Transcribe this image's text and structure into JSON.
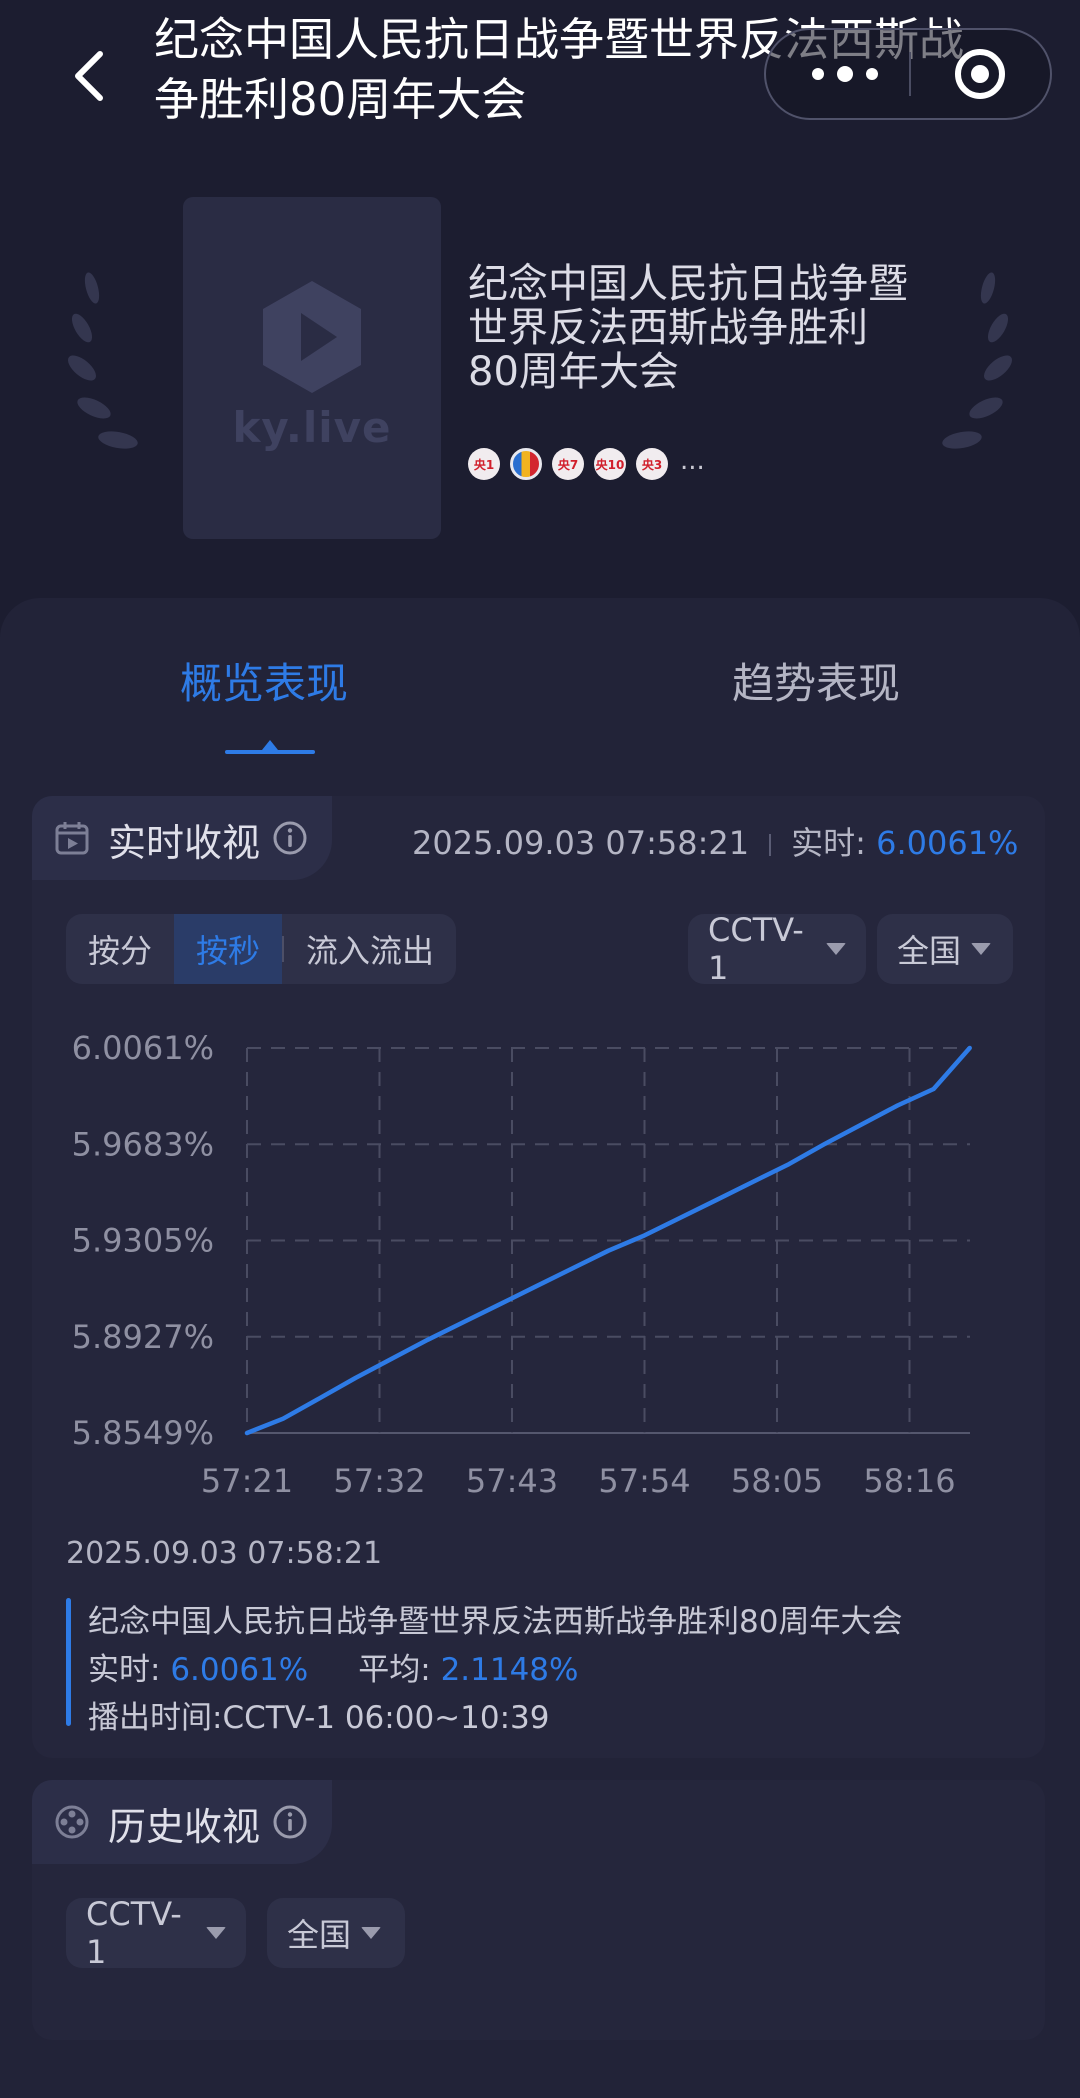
{
  "header": {
    "title": "纪念中国人民抗日战争暨世界反法西斯战争胜利80周年大会"
  },
  "hero": {
    "poster_logo_text": "ky.live",
    "show_name": "纪念中国人民抗日战争暨世界反法西斯战争胜利80周年大会",
    "channels": [
      "央1",
      "",
      "央7",
      "央10",
      "央3"
    ],
    "more": "..."
  },
  "tabs": {
    "overview": "概览表现",
    "trend": "趋势表现"
  },
  "realtime": {
    "title": "实时收视",
    "timestamp": "2025.09.03 07:58:21",
    "live_label": "实时:",
    "live_value": "6.0061%",
    "segments": [
      "按分",
      "按秒",
      "流入流出"
    ],
    "channel_select": "CCTV-1",
    "region_select": "全国"
  },
  "chart_data": {
    "type": "line",
    "y_ticks": [
      "6.0061%",
      "5.9683%",
      "5.9305%",
      "5.8927%",
      "5.8549%"
    ],
    "x_ticks": [
      "57:21",
      "57:32",
      "57:43",
      "57:54",
      "58:05",
      "58:16"
    ],
    "ylim": [
      5.8549,
      6.0061
    ],
    "grid": true,
    "series": [
      {
        "color": "#2e7be6",
        "x": [
          "57:21",
          "57:24",
          "57:27",
          "57:30",
          "57:33",
          "57:36",
          "57:39",
          "57:42",
          "57:45",
          "57:48",
          "57:51",
          "57:54",
          "57:57",
          "58:00",
          "58:03",
          "58:06",
          "58:09",
          "58:12",
          "58:15",
          "58:18",
          "58:21"
        ],
        "values": [
          5.8549,
          5.8605,
          5.8685,
          5.8765,
          5.884,
          5.8915,
          5.8985,
          5.9055,
          5.9125,
          5.9195,
          5.9265,
          5.9325,
          5.9395,
          5.9465,
          5.9535,
          5.9605,
          5.9685,
          5.976,
          5.9835,
          5.99,
          6.0061
        ]
      }
    ]
  },
  "tooltip": {
    "time": "2025.09.03 07:58:21",
    "name": "纪念中国人民抗日战争暨世界反法西斯战争胜利80周年大会",
    "live_label": "实时:",
    "live_value": "6.0061%",
    "avg_label": "平均:",
    "avg_value": "2.1148%",
    "air_label": "播出时间:",
    "air_value": "CCTV-1 06:00~10:39"
  },
  "history": {
    "title": "历史收视",
    "channel_select": "CCTV-1",
    "region_select": "全国"
  },
  "colors": {
    "accent": "#2e7be6",
    "background": "#1c1d30",
    "panel": "#222338"
  }
}
